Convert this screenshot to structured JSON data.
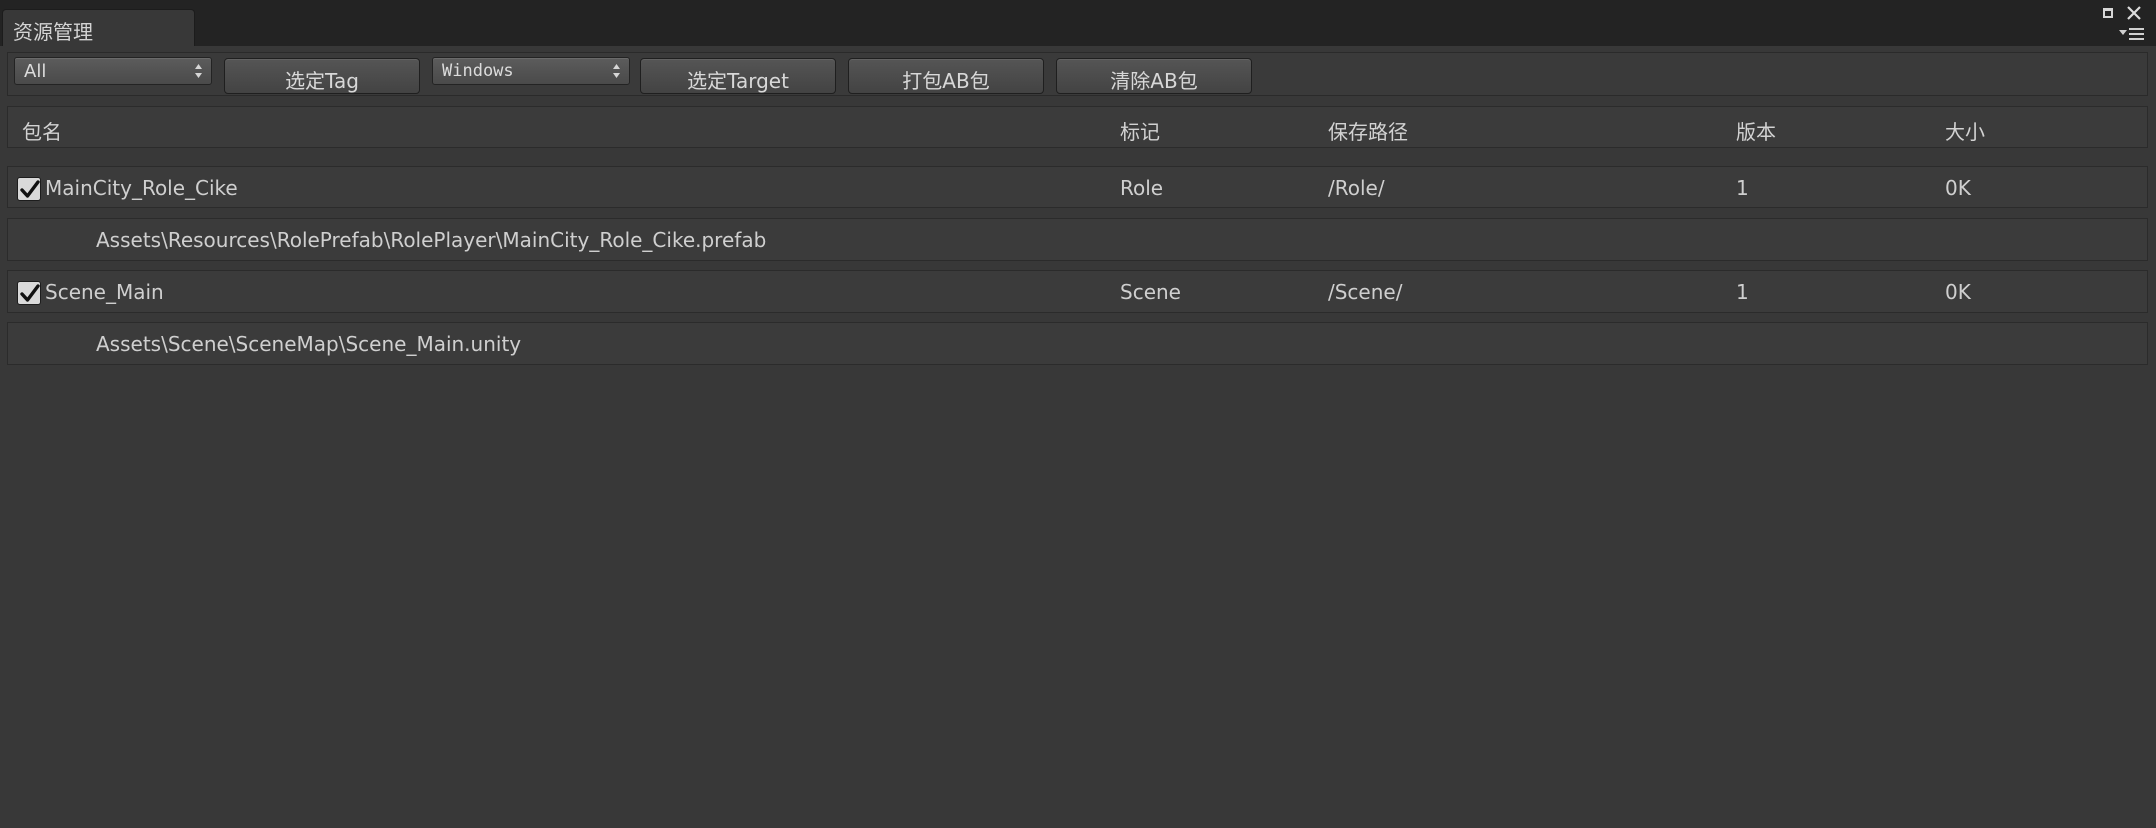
{
  "window": {
    "tab_title": "资源管理"
  },
  "toolbar": {
    "tag_filter_value": "All",
    "select_tag_label": "选定Tag",
    "platform_value": "Windows",
    "select_target_label": "选定Target",
    "build_ab_label": "打包AB包",
    "clear_ab_label": "清除AB包"
  },
  "table": {
    "columns": [
      "包名",
      "标记",
      "保存路径",
      "版本",
      "大小"
    ],
    "bundles": [
      {
        "checked": true,
        "name": "MainCity_Role_Cike",
        "tag": "Role",
        "save_path": "/Role/",
        "version": "1",
        "size": "0K",
        "asset_path": "Assets\\Resources\\RolePrefab\\RolePlayer\\MainCity_Role_Cike.prefab"
      },
      {
        "checked": true,
        "name": "Scene_Main",
        "tag": "Scene",
        "save_path": "/Scene/",
        "version": "1",
        "size": "0K",
        "asset_path": "Assets\\Scene\\SceneMap\\Scene_Main.unity"
      }
    ]
  },
  "icons": {
    "maximize": "maximize-icon",
    "close": "close-icon",
    "menu": "menu-icon",
    "checkbox": "checkmark-icon",
    "popup_arrows": "up-down-arrows-icon"
  },
  "colors": {
    "panel_bg": "#383838",
    "tabstrip_bg": "#232323",
    "row_bg": "#3b3b3b",
    "text": "#c8c8c8"
  }
}
